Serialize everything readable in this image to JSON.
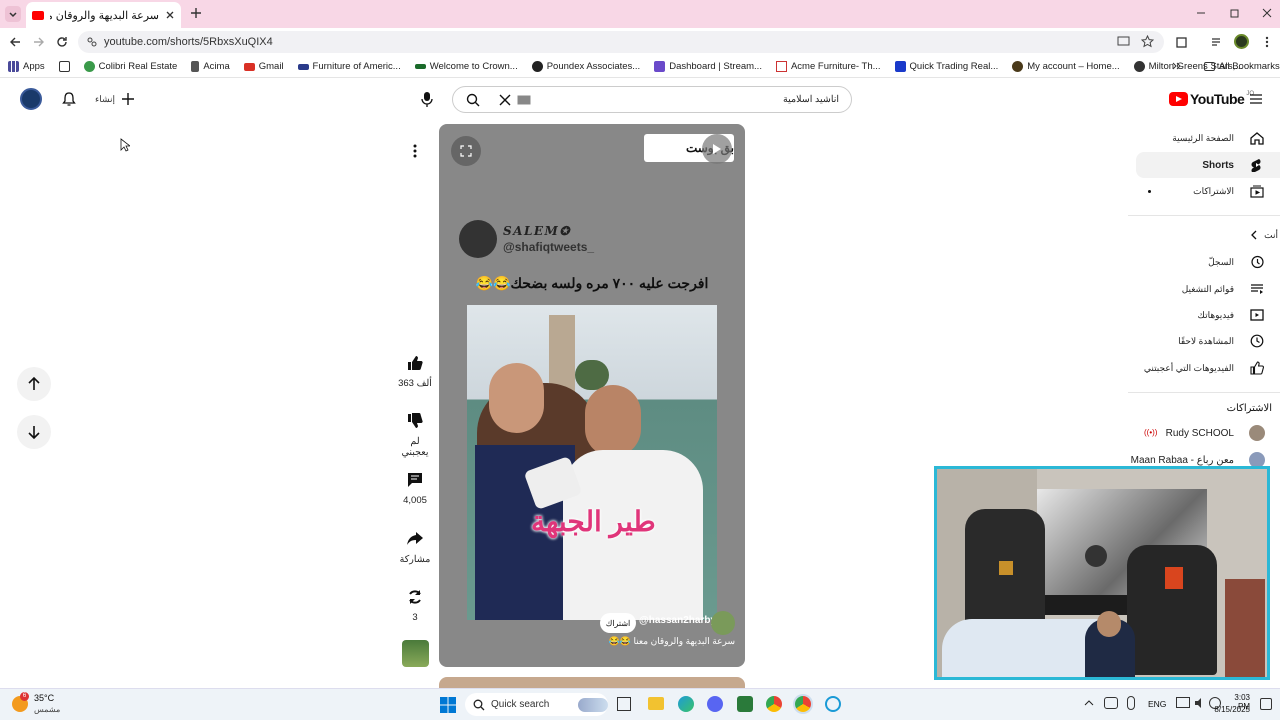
{
  "browser": {
    "tab_title": "سرعة البديهة والروقان معنا 😂😂",
    "url": "youtube.com/shorts/5RbxsXuQIX4",
    "bookmarks": [
      "Apps",
      "Colibri Real Estate",
      "Acima",
      "Gmail",
      "Furniture of Americ...",
      "Welcome to Crown...",
      "Poundex Associates...",
      "Dashboard | Stream...",
      "Acme Furniture- Th...",
      "Quick Trading Real...",
      "My account – Home...",
      "Milton Greens Stars,..."
    ],
    "all_bookmarks": "All Bookmarks"
  },
  "youtube": {
    "create_label": "إنشاء",
    "search_value": "اناشيد اسلامية",
    "logo_text": "YouTube",
    "logo_sup": "JO",
    "sidebar": {
      "home": "الصفحة الرئيسية",
      "shorts": "Shorts",
      "subscriptions": "الاشتراكات",
      "you": "أنت",
      "history": "السجلّ",
      "playlists": "قوائم التشغيل",
      "your_videos": "فيديوهاتك",
      "watch_later": "المشاهدة لاحقًا",
      "liked": "الفيديوهات التي أعجبتني",
      "subs_header": "الاشتراكات",
      "channels": [
        "Rudy SCHOOL",
        "Maan Rabaa - معن رباع"
      ]
    }
  },
  "short": {
    "overlay_text": "بق بوست",
    "tweet_name": "SALEM✪",
    "tweet_handle": "@shafiqtweets_",
    "caption": "افرجت عليه ٧٠٠ مره ولسه بضحك😂😂",
    "video_text": "طير الجبهة",
    "channel": "@hassan2harby",
    "subscribe": "اشتراك",
    "title": "سرعة البديهة والروقان معنا 😂😂"
  },
  "actions": {
    "likes": "363 ألف",
    "dislike": "لم يعجبني",
    "comments": "4,005",
    "share": "مشاركة",
    "remix": "3"
  },
  "taskbar": {
    "temp": "35°C",
    "weather": "مشمس",
    "badge": "6",
    "search": "Quick search",
    "lang": "ENG",
    "time": "3:03 PM",
    "date": "8/15/2025"
  }
}
